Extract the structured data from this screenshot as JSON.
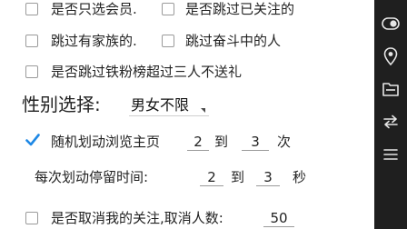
{
  "options": {
    "only_member": {
      "label": "是否只选会员.",
      "checked": false
    },
    "skip_followed": {
      "label": "是否跳过已关注的",
      "checked": false
    },
    "skip_family": {
      "label": "跳过有家族的.",
      "checked": false
    },
    "skip_striving": {
      "label": "跳过奋斗中的人",
      "checked": false
    },
    "skip_fan_rank": {
      "label": "是否跳过铁粉榜超过三人不送礼",
      "checked": false
    }
  },
  "gender": {
    "label": "性别选择:",
    "value": "男女不限"
  },
  "random_browse": {
    "label": "随机划动浏览主页",
    "checked": true,
    "min": "2",
    "to": "到",
    "max": "3",
    "unit": "次"
  },
  "stay_time": {
    "label": "每次划动停留时间:",
    "min": "2",
    "to": "到",
    "max": "3",
    "unit": "秒"
  },
  "unfollow": {
    "label": "是否取消我的关注,取消人数:",
    "checked": false,
    "count": "50"
  },
  "colors": {
    "accent": "#1e88e5",
    "navbar": "#1f1f1f"
  },
  "nav_icons": [
    "toggle-icon",
    "location-icon",
    "folder-icon",
    "switch-icon",
    "more-icon"
  ]
}
